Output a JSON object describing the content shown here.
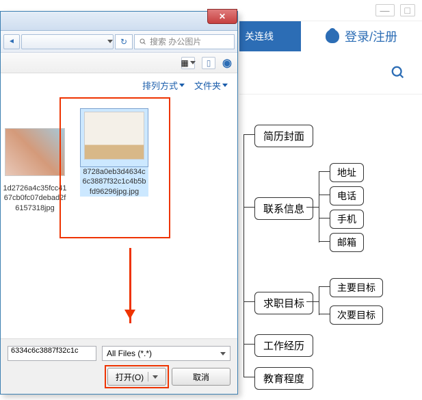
{
  "bgPage": {
    "navText": "关连线",
    "loginText": "登录/注册"
  },
  "mindmap": {
    "n1": "简历封面",
    "n2": "联系信息",
    "n2_1": "地址",
    "n2_2": "电话",
    "n2_3": "手机",
    "n2_4": "邮箱",
    "n3": "求职目标",
    "n3_1": "主要目标",
    "n3_2": "次要目标",
    "n4": "工作经历",
    "n5": "教育程度"
  },
  "dialog": {
    "searchPlaceholder": "搜索 办公图片",
    "sortLabel": "排列方式",
    "folderLabel": "文件夹",
    "file1": "1d2726a4c35fcc4167cb0fc07debad2f6157318jpg",
    "file2": "8728a0eb3d4634c6c3887f32c1c4b5bfd96296jpg.jpg",
    "filenameValue": "6334c6c3887f32c1c",
    "filterValue": "All Files (*.*)",
    "openBtn": "打开(O)",
    "cancelBtn": "取消"
  }
}
